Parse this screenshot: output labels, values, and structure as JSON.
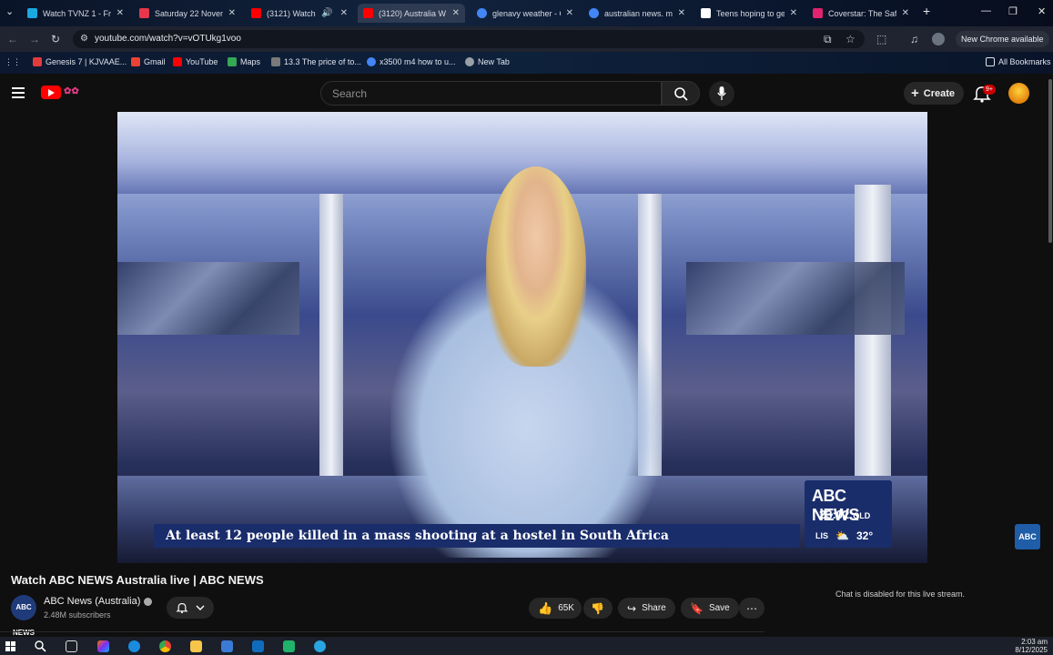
{
  "browser": {
    "tabs": [
      {
        "title": "Watch TVNZ 1 - Fre",
        "color": "#1aa9e0"
      },
      {
        "title": "Saturday 22 Novem",
        "color": "#e8364b"
      },
      {
        "title": "(3121) Watch Al",
        "color": "#ff0000"
      },
      {
        "title": "(3120) Australia W",
        "color": "#ff0000"
      },
      {
        "title": "glenavy weather - C",
        "color": "#4285f4"
      },
      {
        "title": "australian news. mi",
        "color": "#4285f4"
      },
      {
        "title": "Teens hoping to ge",
        "color": "#ffffff"
      },
      {
        "title": "Coverstar: The Safe",
        "color": "#e0246f"
      }
    ],
    "url": "youtube.com/watch?v=vOTUkg1voo",
    "update_chip": "New Chrome available",
    "bookmarks": [
      {
        "label": "Genesis 7 | KJVAAE...",
        "color": "#e23b3b"
      },
      {
        "label": "Gmail",
        "color": "#ea4335"
      },
      {
        "label": "YouTube",
        "color": "#ff0000"
      },
      {
        "label": "Maps",
        "color": "#34a853"
      },
      {
        "label": "13.3 The price of to...",
        "color": "#7a7a7a"
      },
      {
        "label": "x3500 m4 how to u...",
        "color": "#4285f4"
      },
      {
        "label": "New Tab",
        "color": "#9aa0a6"
      }
    ],
    "all_bookmarks": "All Bookmarks"
  },
  "youtube": {
    "search_placeholder": "Search",
    "create_label": "Create",
    "notification_count": "9+",
    "video": {
      "ticker": "At least 12 people killed in a mass shooting at a hostel in South Africa",
      "network": "ABC NEWS",
      "time": "23:02",
      "zone": "QLD",
      "location": "LIS",
      "temperature": "32°"
    },
    "title": "Watch ABC NEWS Australia live | ABC NEWS",
    "channel": {
      "name": "ABC News (Australia)",
      "subscribers": "2.48M subscribers",
      "avatar_text": "ABC NEWS"
    },
    "actions": {
      "likes": "65K",
      "share": "Share",
      "save": "Save"
    },
    "chat_message": "Chat is disabled for this live stream."
  },
  "taskbar": {
    "time": "2:03 am",
    "date": "8/12/2025"
  }
}
